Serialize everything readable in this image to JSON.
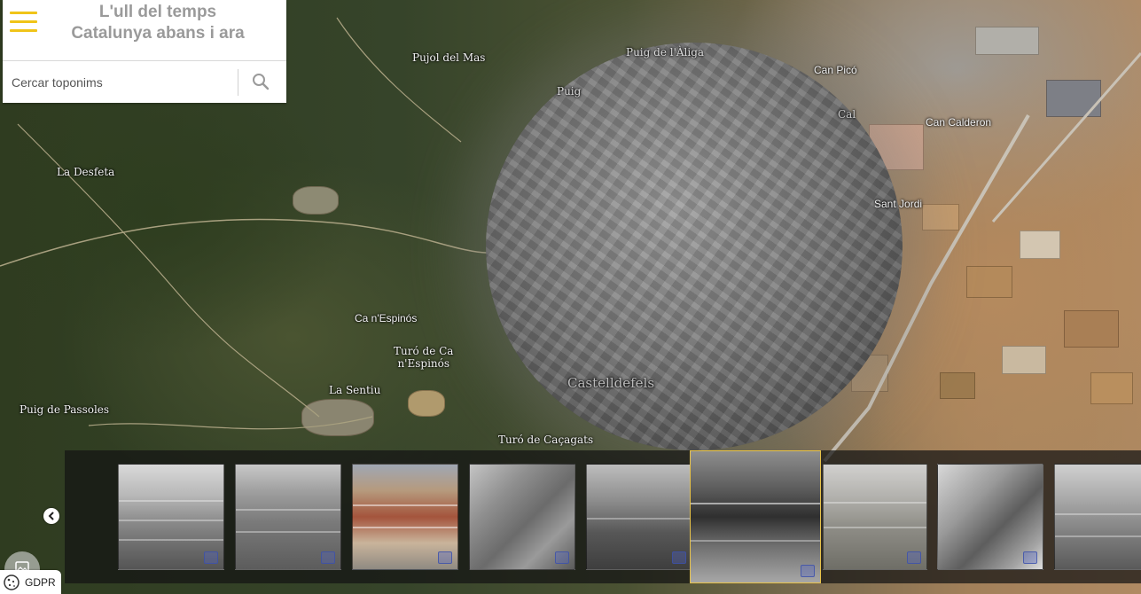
{
  "app": {
    "title_line1": "L'ull del temps",
    "title_line2": "Catalunya abans i ara"
  },
  "search": {
    "placeholder": "Cercar toponims"
  },
  "map": {
    "labels": [
      "Pujol del Mas",
      "Puig de l'Àliga",
      "Can Picó",
      "Can Calderon",
      "Puig",
      "Sant Jordi",
      "La Desfeta",
      "Ca n'Espinós",
      "Turó de Ca\nn'Espinós",
      "La Sentiu",
      "Puig de Passoles",
      "Turó de Caçagats",
      "Cal",
      "Castelldefels"
    ]
  },
  "photo_strip": {
    "thumbnails": [
      {
        "tone": "bw-housing"
      },
      {
        "tone": "bw-industrial"
      },
      {
        "tone": "color-industrial"
      },
      {
        "tone": "bw-aerial-fields"
      },
      {
        "tone": "bw-aerial-factory"
      },
      {
        "tone": "bw-factory-closeup",
        "active": true
      },
      {
        "tone": "color-faded-industrial"
      },
      {
        "tone": "bw-aerial-vertical"
      },
      {
        "tone": "bw-partial"
      }
    ],
    "prev_icon": "chevron-left-icon"
  },
  "footer": {
    "gdpr_label": "GDPR",
    "gdpr_icon": "cookie-icon",
    "layer_icon": "image-icon"
  },
  "colors": {
    "accent": "#f0c419",
    "title_text": "#9a9a9a",
    "active_thumb_border": "#e8c34a"
  }
}
